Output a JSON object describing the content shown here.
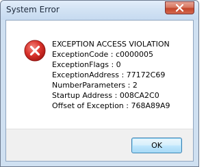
{
  "window": {
    "title": "System Error"
  },
  "title_bar": {
    "close_icon": "close-icon"
  },
  "dialog": {
    "icon": "error-icon",
    "message_lines": [
      "EXCEPTION ACCESS VIOLATION",
      "ExceptionCode : c0000005",
      "ExceptionFlags : 0",
      "ExceptionAddress : 77172C69",
      "NumberParameters : 2",
      "Startup Address : 008CA2C0",
      "Offset of Exception : 768A89A9"
    ],
    "ok_label": "OK"
  },
  "colors": {
    "error_icon_fill": "#d9322b",
    "close_button": "#c4462b",
    "frame": "#cfe0f1"
  }
}
